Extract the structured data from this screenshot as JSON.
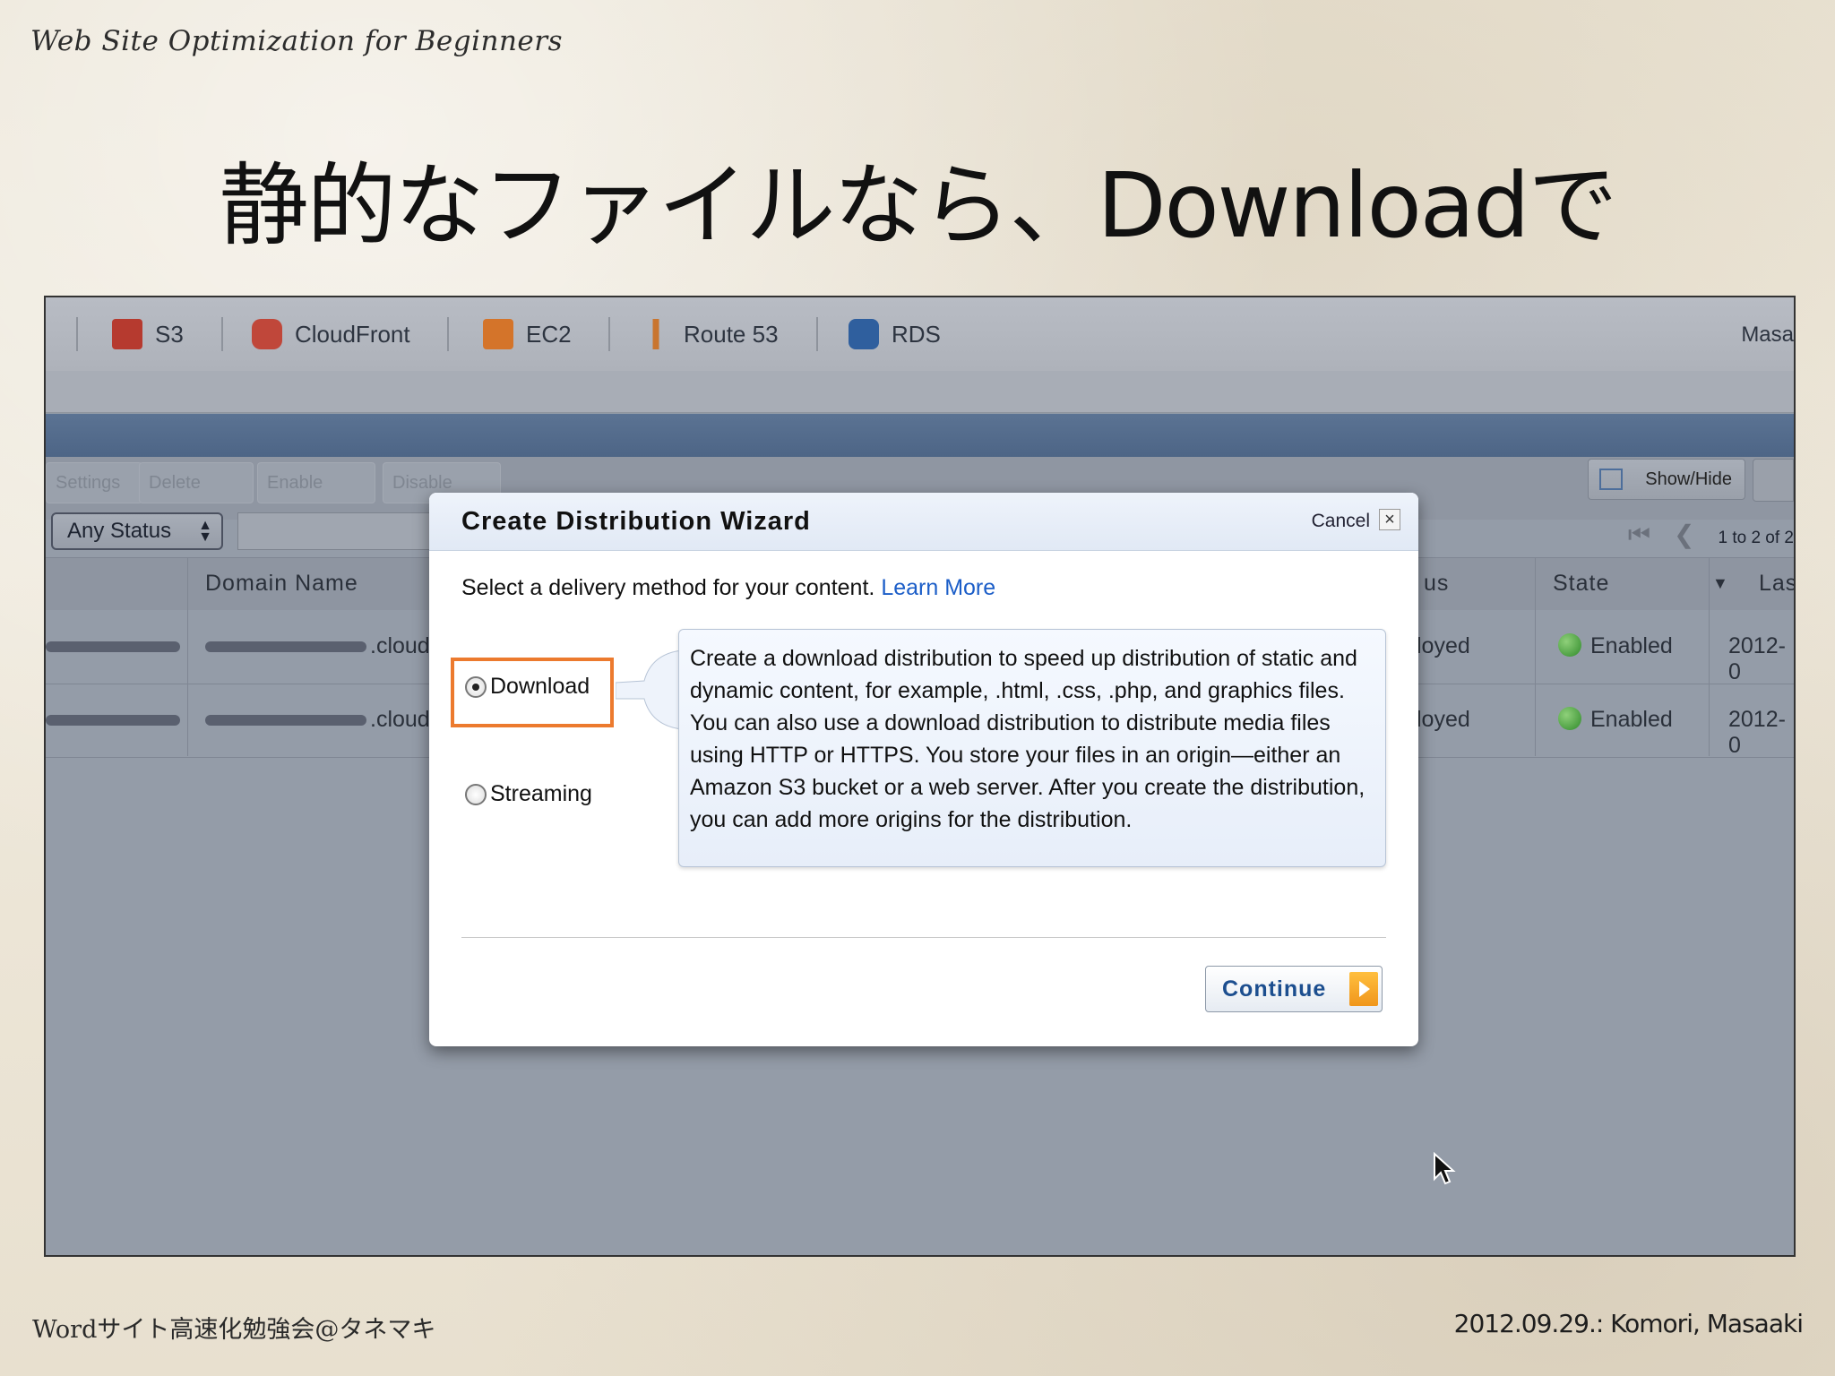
{
  "slide": {
    "subtitle": "Web Site Optimization for Beginners",
    "title": "静的なファイルなら、Downloadで",
    "footer_left": "Wordサイト高速化勉強会@タネマキ",
    "footer_right": "2012.09.29.: Komori, Masaaki"
  },
  "nav": {
    "items": [
      {
        "label": "S3",
        "icon": "s3-icon",
        "color": "#b63a2f"
      },
      {
        "label": "CloudFront",
        "icon": "cloudfront-icon",
        "color": "#c0473a"
      },
      {
        "label": "EC2",
        "icon": "ec2-icon",
        "color": "#d4742a"
      },
      {
        "label": "Route 53",
        "icon": "route53-icon",
        "color": "#c9752f"
      },
      {
        "label": "RDS",
        "icon": "rds-icon",
        "color": "#2f5f9e"
      }
    ],
    "user": "Masa"
  },
  "toolbar": {
    "settings": "Settings",
    "delete": "Delete",
    "enable": "Enable",
    "disable": "Disable",
    "show_hide": "Show/Hide"
  },
  "filter": {
    "status": "Any Status",
    "pager": "1 to 2 of 2"
  },
  "table": {
    "headers": {
      "domain": "Domain Name",
      "status_partial": "us",
      "state": "State",
      "last_partial": "Las"
    },
    "rows": [
      {
        "domain_suffix": ".cloud",
        "status_partial": "loyed",
        "state": "Enabled",
        "date_partial": "2012-0"
      },
      {
        "domain_suffix": ".cloud",
        "status_partial": "loyed",
        "state": "Enabled",
        "date_partial": "2012-0"
      }
    ]
  },
  "dialog": {
    "title": "Create Distribution Wizard",
    "cancel": "Cancel",
    "prompt": "Select a delivery method for your content.",
    "learn_more": "Learn More",
    "options": [
      {
        "label": "Download",
        "selected": true
      },
      {
        "label": "Streaming",
        "selected": false
      }
    ],
    "description": "Create a download distribution to speed up distribution of static and dynamic content, for example, .html, .css, .php, and graphics files. You can also use a download distribution to distribute media files using HTTP or HTTPS. You store your files in an origin—either an Amazon S3 bucket or a web server. After you create the distribution, you can add more origins for the distribution.",
    "continue": "Continue",
    "highlight_color": "#ec7a2e"
  }
}
